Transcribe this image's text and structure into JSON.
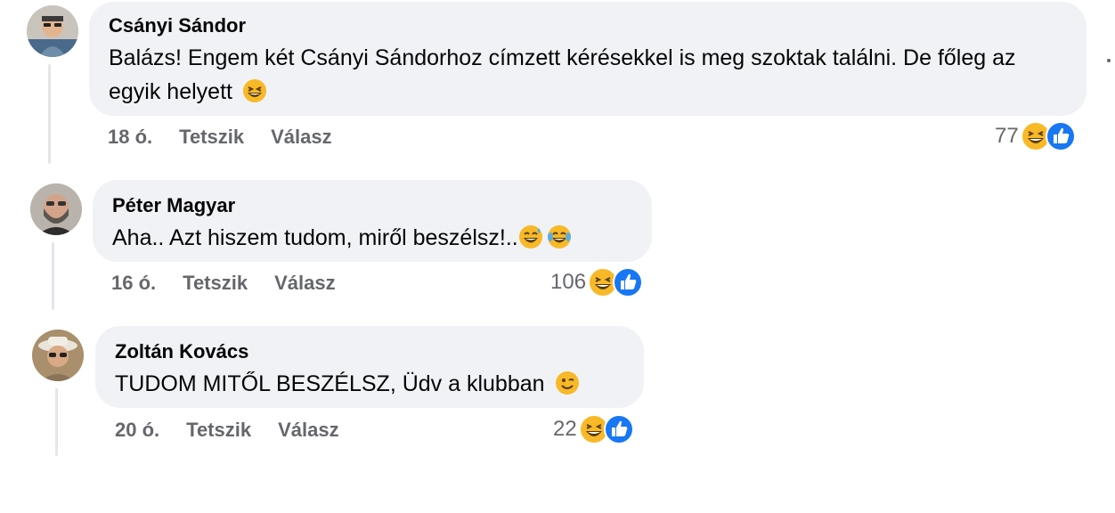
{
  "comments": [
    {
      "author": "Csányi Sándor",
      "text": "Balázs! Engem két Csányi Sándorhoz címzett kérésekkel is meg szoktak találni. De főleg az egyik helyett",
      "time": "18 ó.",
      "like_label": "Tetszik",
      "reply_label": "Válasz",
      "reaction_count": "77",
      "inline_emoji": "grinning-squinting-emoji"
    },
    {
      "author": "Péter Magyar",
      "text": "Aha.. Azt hiszem tudom, miről beszélsz!..",
      "time": "16 ó.",
      "like_label": "Tetszik",
      "reply_label": "Válasz",
      "reaction_count": "106",
      "inline_emoji": "sweat-smile-emoji, tears-of-joy-emoji"
    },
    {
      "author": "Zoltán Kovács",
      "text": "TUDOM MITŐL BESZÉLSZ, Üdv a klubban",
      "time": "20 ó.",
      "like_label": "Tetszik",
      "reply_label": "Válasz",
      "reaction_count": "22",
      "inline_emoji": "winking-emoji"
    }
  ],
  "colors": {
    "bubble": "#f0f2f5",
    "meta_text": "#65676b",
    "like_blue": "#1877f2",
    "haha_yellow": "#f7b928"
  }
}
